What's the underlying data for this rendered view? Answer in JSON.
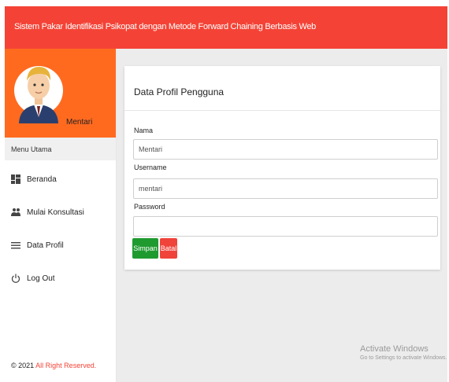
{
  "header": {
    "title": "Sistem Pakar Identifikasi Psikopat dengan Metode Forward Chaining Berbasis Web",
    "color": "#f44336"
  },
  "sidebar": {
    "user_name": "Mentari",
    "profile_bg": "#ff6a1f",
    "menu_heading": "Menu Utama",
    "items": [
      {
        "label": "Beranda",
        "icon": "dashboard-icon"
      },
      {
        "label": "Mulai Konsultasi",
        "icon": "users-icon"
      },
      {
        "label": "Data Profil",
        "icon": "list-icon"
      },
      {
        "label": "Log Out",
        "icon": "power-icon"
      }
    ],
    "footer": {
      "prefix": "© 2021",
      "accent": "All Right Reserved."
    }
  },
  "card": {
    "title": "Data Profil Pengguna",
    "fields": [
      {
        "label": "Nama",
        "value": "Mentari"
      },
      {
        "label": "Username",
        "value": "mentari"
      },
      {
        "label": "Password",
        "value": ""
      }
    ],
    "buttons": {
      "save": "Simpan",
      "cancel": "Batal"
    }
  },
  "watermark": {
    "line1": "Activate Windows",
    "line2": "Go to Settings to activate Windows."
  }
}
